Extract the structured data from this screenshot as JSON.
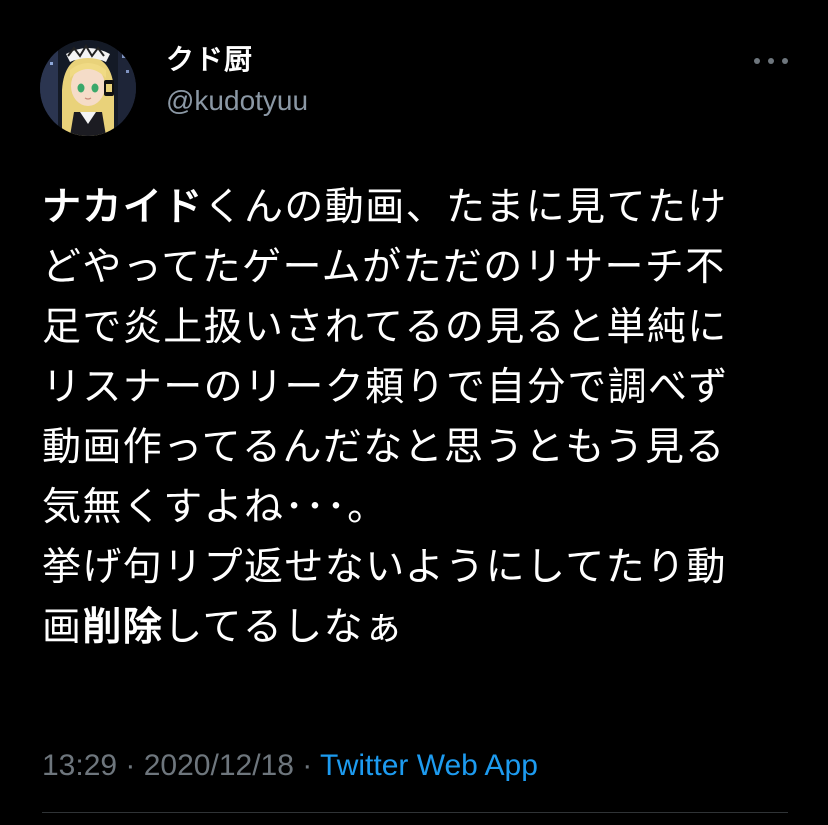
{
  "author": {
    "display_name": "クド厨",
    "handle": "@kudotyuu"
  },
  "more_icon": "ellipsis-icon",
  "tweet": {
    "segments": [
      {
        "text": "ナカイド",
        "bold": true
      },
      {
        "text": "くんの動画、たまに見てたけ\nどやってたゲームがただのリサーチ不\n足で炎上扱いされてるの見ると単純に\nリスナーのリーク頼りで自分で調べず\n動画作ってるんだなと思うともう見る\n気無くすよね･･･。\n挙げ句リプ返せないようにしてたり動\n画",
        "bold": false
      },
      {
        "text": "削除",
        "bold": true
      },
      {
        "text": "してるしなぁ",
        "bold": false
      }
    ]
  },
  "meta": {
    "time": "13:29",
    "separator": " · ",
    "date": "2020/12/18",
    "source": "Twitter Web App"
  },
  "colors": {
    "background": "#000000",
    "text": "#ffffff",
    "secondary": "#8b98a5",
    "link": "#1d9bf0",
    "divider": "#2f3336"
  }
}
